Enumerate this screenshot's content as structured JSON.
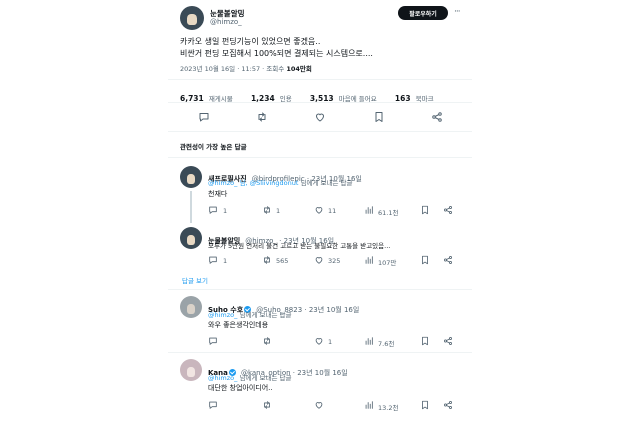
{
  "main_tweet": {
    "display_name": "눈물볼알밍",
    "handle": "@himzo_",
    "follow_label": "팔로우하기",
    "more": "···",
    "text_line1": "카카오 생일 펀딩기능이 있었으면 좋겠음..",
    "text_line2": "비싼거 펀딩 모집해서 100%되면 결제되는 시스템으로....",
    "timestamp": "2023년 10월 16일 · 11:57 · 조회수",
    "views": "104만회",
    "stats": {
      "retweets": "6,731",
      "retweets_label": "재게시물",
      "quotes": "1,234",
      "quotes_label": "인용",
      "likes": "3,513",
      "likes_label": "마음에 들어요",
      "bookmarks": "163",
      "bookmarks_label": "북마크"
    }
  },
  "replies_header": "관련성이 가장 높은 답글",
  "replies": [
    {
      "display_name": "새프로필사진",
      "handle": "@birdprofilepic · 23년 10월 16일",
      "reply_prefix": "@himzo_ 님, @Sliivingdonut",
      "reply_suffix": "님에게 보내는 답글",
      "text": "천재다",
      "comments": "1",
      "retweets": "1",
      "likes": "11",
      "views": "61.1천"
    },
    {
      "display_name": "눈물볼알밍",
      "handle": "@himzo_ · 23년 10월 16일",
      "text": "모두가 5만원 언저리 물건 고르고 받는 불필요한 고통을 받고있음...",
      "comments": "1",
      "retweets": "565",
      "likes": "325",
      "views": "107만",
      "show_replies": "답글 보기"
    },
    {
      "display_name": "Suho 수호",
      "handle": "@Suho_8823 · 23년 10월 16일",
      "reply_prefix": "@himzo_",
      "reply_suffix": "님에게 보내는 답글",
      "text": "와우 좋은생각인데용",
      "comments": "",
      "retweets": "",
      "likes": "1",
      "views": "7.6천"
    },
    {
      "display_name": "Kana",
      "handle": "@kana_option · 23년 10월 16일",
      "reply_prefix": "@himzo_",
      "reply_suffix": "님에게 보내는 답글",
      "text": "대단한 창업아이디어..",
      "comments": "",
      "retweets": "",
      "likes": "",
      "views": "13.2천"
    }
  ],
  "colors": {
    "accent": "#1d9bf0",
    "text": "#0f1419",
    "muted": "#536471",
    "divider": "#eff3f4"
  }
}
